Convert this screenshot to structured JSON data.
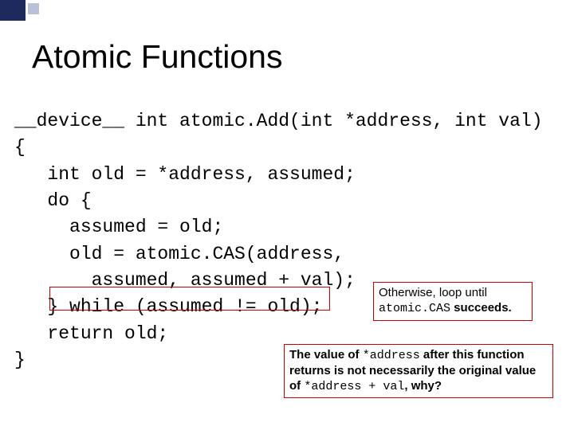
{
  "title": "Atomic Functions",
  "code": {
    "l1": "__device__ int atomic.Add(int *address, int val)",
    "l2": "{",
    "l3": "   int old = *address, assumed;",
    "l4": "   do {",
    "l5": "     assumed = old;",
    "l6": "     old = atomic.CAS(address,",
    "l7": "       assumed, assumed + val);",
    "l8": "   } while (assumed != old);",
    "l9": "   return old;",
    "l10": "}"
  },
  "notes": {
    "n1a": "Otherwise, loop until",
    "n1b_code": "atomic.CAS",
    "n1b_after": " succeeds.",
    "n2a_before": "The value of ",
    "n2a_code": "*address",
    "n2a_after": " after this function",
    "n2b": "returns is not necessarily the original value",
    "n2c_before": "of ",
    "n2c_code": "*address + val",
    "n2c_after": ", why?"
  }
}
